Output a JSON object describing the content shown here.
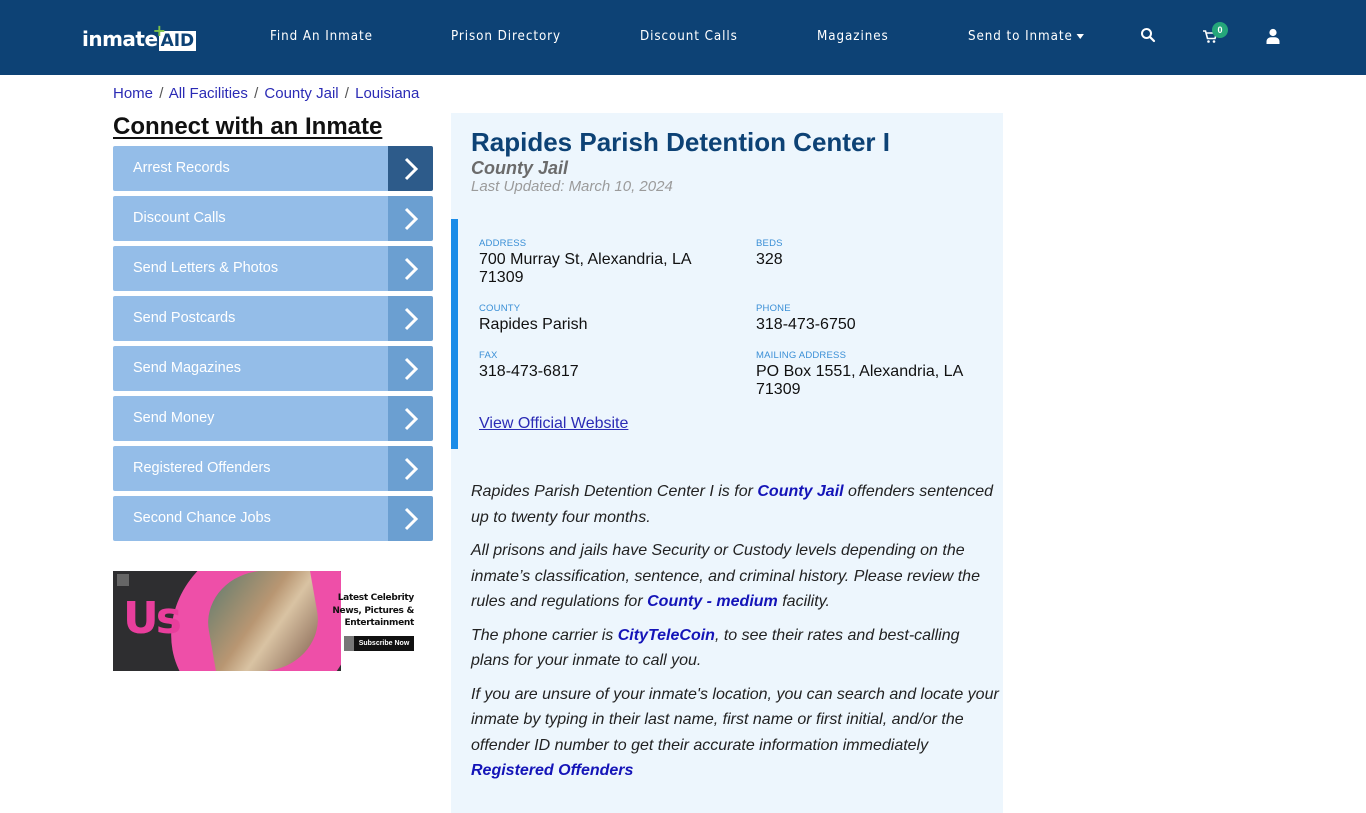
{
  "nav": {
    "logo_text": "inmate",
    "logo_aid": "AID",
    "items": [
      {
        "label": "Find An Inmate"
      },
      {
        "label": "Prison Directory"
      },
      {
        "label": "Discount Calls"
      },
      {
        "label": "Magazines"
      },
      {
        "label": "Send to Inmate"
      }
    ],
    "cart_count": "0",
    "icons": [
      "search-icon",
      "cart-icon",
      "user-icon"
    ]
  },
  "breadcrumb": [
    {
      "label": "Home"
    },
    {
      "label": "All Facilities"
    },
    {
      "label": "County Jail"
    },
    {
      "label": "Louisiana"
    }
  ],
  "breadcrumb_separator": "/",
  "sidebar": {
    "title": "Connect with an Inmate",
    "items": [
      {
        "label": "Arrest Records"
      },
      {
        "label": "Discount Calls"
      },
      {
        "label": "Send Letters & Photos"
      },
      {
        "label": "Send Postcards"
      },
      {
        "label": "Send Magazines"
      },
      {
        "label": "Send Money"
      },
      {
        "label": "Registered Offenders"
      },
      {
        "label": "Second Chance Jobs"
      }
    ]
  },
  "ad": {
    "brand": "Us",
    "line1": "Latest Celebrity",
    "line2": "News, Pictures &",
    "line3": "Entertainment",
    "button": "Subscribe Now"
  },
  "facility": {
    "name": "Rapides Parish Detention Center I",
    "type": "County Jail",
    "last_updated": "Last Updated: March 10, 2024",
    "fields": {
      "address": {
        "label": "Address",
        "value": "700 Murray St, Alexandria, LA 71309"
      },
      "beds": {
        "label": "Beds",
        "value": "328"
      },
      "county": {
        "label": "County",
        "value": "Rapides Parish"
      },
      "phone": {
        "label": "Phone",
        "value": "318-473-6750"
      },
      "fax": {
        "label": "Fax",
        "value": "318-473-6817"
      },
      "mailing": {
        "label": "Mailing Address",
        "value": "PO Box 1551, Alexandria, LA 71309"
      }
    },
    "website_link": "View Official Website"
  },
  "description": {
    "p1_a": "Rapides Parish Detention Center I is for ",
    "p1_link": "County Jail",
    "p1_b": " offenders sentenced up to twenty four months.",
    "p2_a": "All prisons and jails have Security or Custody levels depending on the inmate’s classification, sentence, and criminal history. Please review the rules and regulations for ",
    "p2_link": "County - medium",
    "p2_b": " facility.",
    "p3_a": "The phone carrier is ",
    "p3_link": "CityTeleCoin",
    "p3_b": ", to see their rates and best-calling plans for your inmate to call you.",
    "p4": "If you are unsure of your inmate's location, you can search and locate your inmate by typing in their last name, first name or first initial, and/or the offender ID number to get their accurate information immediately",
    "p4_link": "Registered Offenders"
  },
  "colors": {
    "navbar": "#0d4275",
    "accent_blue": "#1a8ce8",
    "sidebar_item": "#94bde8",
    "sidebar_arrow": "#6b9fd1",
    "sidebar_arrow_active": "#2d5b8a",
    "badge": "#25a67a"
  }
}
